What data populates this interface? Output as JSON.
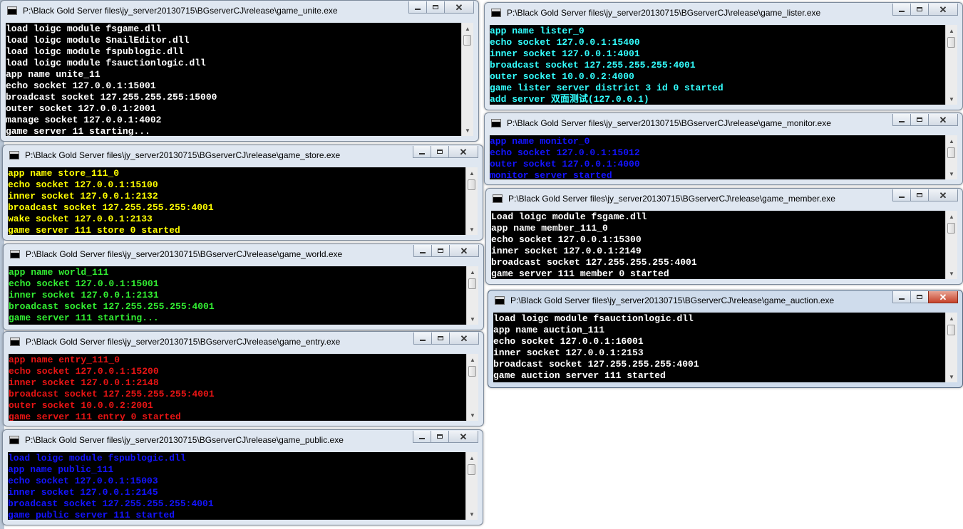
{
  "colors": {
    "white": "#ffffff",
    "yellow": "#ffff00",
    "green": "#32ee32",
    "red": "#e81414",
    "blue": "#1414ff",
    "cyan": "#33ffff"
  },
  "icons": {
    "app": "console-app-icon",
    "minimize": "minimize-icon",
    "maximize": "maximize-icon",
    "close": "close-icon",
    "scroll_up": "scroll-up-arrow-icon",
    "scroll_down": "scroll-down-arrow-icon"
  },
  "windows": [
    {
      "id": "unite",
      "title": "P:\\Black Gold Server files\\jy_server20130715\\BGserverCJ\\release\\game_unite.exe",
      "color": "#ffffff",
      "lines": [
        "load loigc module fsgame.dll",
        "load loigc module SnailEditor.dll",
        "load loigc module fspublogic.dll",
        "load loigc module fsauctionlogic.dll",
        "app name unite_11",
        "echo socket 127.0.0.1:15001",
        "broadcast socket 127.255.255.255:15000",
        "outer socket 127.0.0.1:2001",
        "manage socket 127.0.0.1:4002",
        "game server 11 starting..."
      ]
    },
    {
      "id": "store",
      "title": "P:\\Black Gold Server files\\jy_server20130715\\BGserverCJ\\release\\game_store.exe",
      "color": "#ffff00",
      "lines": [
        "app name store_111_0",
        "echo socket 127.0.0.1:15100",
        "inner socket 127.0.0.1:2132",
        "broadcast socket 127.255.255.255:4001",
        "wake socket 127.0.0.1:2133",
        "game server 111 store 0 started"
      ]
    },
    {
      "id": "world",
      "title": "P:\\Black Gold Server files\\jy_server20130715\\BGserverCJ\\release\\game_world.exe",
      "color": "#32ee32",
      "lines": [
        "app name world_111",
        "echo socket 127.0.0.1:15001",
        "inner socket 127.0.0.1:2131",
        "broadcast socket 127.255.255.255:4001",
        "game server 111 starting..."
      ]
    },
    {
      "id": "entry",
      "title": "P:\\Black Gold Server files\\jy_server20130715\\BGserverCJ\\release\\game_entry.exe",
      "color": "#e81414",
      "lines": [
        "app name entry_111_0",
        "echo socket 127.0.0.1:15200",
        "inner socket 127.0.0.1:2148",
        "broadcast socket 127.255.255.255:4001",
        "outer socket 10.0.0.2:2001",
        "game server 111 entry 0 started"
      ]
    },
    {
      "id": "public",
      "title": "P:\\Black Gold Server files\\jy_server20130715\\BGserverCJ\\release\\game_public.exe",
      "color": "#1414ff",
      "lines": [
        "load loigc module fspublogic.dll",
        "app name public_111",
        "echo socket 127.0.0.1:15003",
        "inner socket 127.0.0.1:2145",
        "broadcast socket 127.255.255.255:4001",
        "game public server 111 started"
      ]
    },
    {
      "id": "lister",
      "title": "P:\\Black Gold Server files\\jy_server20130715\\BGserverCJ\\release\\game_lister.exe",
      "color": "#33ffff",
      "lines": [
        "app name lister_0",
        "echo socket 127.0.0.1:15400",
        "inner socket 127.0.0.1:4001",
        "broadcast socket 127.255.255.255:4001",
        "outer socket 10.0.0.2:4000",
        "game lister server district 3 id 0 started",
        "add server 双面测试(127.0.0.1)"
      ]
    },
    {
      "id": "monitor",
      "title": "P:\\Black Gold Server files\\jy_server20130715\\BGserverCJ\\release\\game_monitor.exe",
      "color": "#1414ff",
      "lines": [
        "app name monitor_0",
        "echo socket 127.0.0.1:15012",
        "outer socket 127.0.0.1:4000",
        "monitor server started"
      ]
    },
    {
      "id": "member",
      "title": "P:\\Black Gold Server files\\jy_server20130715\\BGserverCJ\\release\\game_member.exe",
      "color": "#ffffff",
      "lines": [
        "Load loigc module fsgame.dll",
        "app name member_111_0",
        "echo socket 127.0.0.1:15300",
        "inner socket 127.0.0.1:2149",
        "broadcast socket 127.255.255.255:4001",
        "game server 111 member 0 started"
      ]
    },
    {
      "id": "auction",
      "title": "P:\\Black Gold Server files\\jy_server20130715\\BGserverCJ\\release\\game_auction.exe",
      "color": "#ffffff",
      "lines": [
        "load loigc module fsauctionlogic.dll",
        "app name auction_111",
        "echo socket 127.0.0.1:16001",
        "inner socket 127.0.0.1:2153",
        "broadcast socket 127.255.255.255:4001",
        "game auction server 111 started"
      ]
    }
  ]
}
